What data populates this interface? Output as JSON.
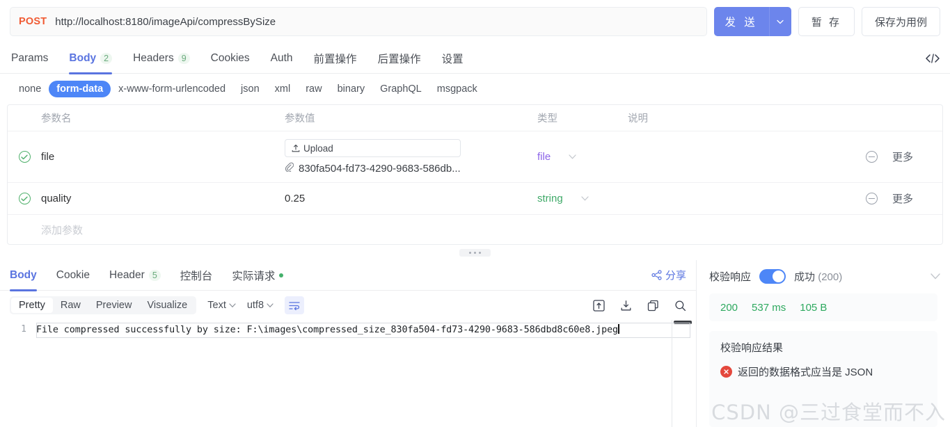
{
  "request": {
    "method": "POST",
    "url": "http://localhost:8180/imageApi/compressBySize",
    "send_label": "发 送",
    "stash_label": "暂 存",
    "save_case_label": "保存为用例"
  },
  "request_tabs": [
    {
      "label": "Params",
      "count": ""
    },
    {
      "label": "Body",
      "count": "2"
    },
    {
      "label": "Headers",
      "count": "9"
    },
    {
      "label": "Cookies",
      "count": ""
    },
    {
      "label": "Auth",
      "count": ""
    },
    {
      "label": "前置操作",
      "count": ""
    },
    {
      "label": "后置操作",
      "count": ""
    },
    {
      "label": "设置",
      "count": ""
    }
  ],
  "body_types": [
    "none",
    "form-data",
    "x-www-form-urlencoded",
    "json",
    "xml",
    "raw",
    "binary",
    "GraphQL",
    "msgpack"
  ],
  "body_type_active": "form-data",
  "param_table": {
    "headers": {
      "name": "参数名",
      "value": "参数值",
      "type": "类型",
      "desc": "说明"
    },
    "more_label": "更多",
    "upload_label": "Upload",
    "add_placeholder": "添加参数",
    "rows": [
      {
        "name": "file",
        "value": "",
        "file_name": "830fa504-fd73-4290-9683-586db...",
        "type": "file",
        "desc": ""
      },
      {
        "name": "quality",
        "value": "0.25",
        "file_name": "",
        "type": "string",
        "desc": ""
      }
    ]
  },
  "response_tabs": [
    {
      "label": "Body",
      "count": ""
    },
    {
      "label": "Cookie",
      "count": ""
    },
    {
      "label": "Header",
      "count": "5"
    },
    {
      "label": "控制台",
      "count": ""
    },
    {
      "label": "实际请求",
      "count": ""
    }
  ],
  "share_label": "分享",
  "format_bar": {
    "segments": [
      "Pretty",
      "Raw",
      "Preview",
      "Visualize"
    ],
    "active_segment": "Pretty",
    "type_dropdown": "Text",
    "encoding_dropdown": "utf8"
  },
  "response_body": {
    "line_number": "1",
    "text": "File compressed successfully by size: F:\\images\\compressed_size_830fa504-fd73-4290-9683-586dbd8c60e8.jpeg"
  },
  "verify_panel": {
    "label": "校验响应",
    "toggle_on": true,
    "status_text": "成功",
    "status_code_text": "(200)",
    "status_code": "200",
    "duration": "537 ms",
    "size": "105 B",
    "result_title": "校验响应结果",
    "result_error": "返回的数据格式应当是 JSON"
  },
  "watermark": "CSDN @三过食堂而不入",
  "colors": {
    "accent": "#5a74e0",
    "primary_button": "#6c85ec",
    "method": "#f05b34",
    "pill_active": "#4d86f7",
    "type_file": "#8b63e8",
    "type_string": "#3fa968",
    "success": "#2ea95f",
    "error": "#e4483d"
  }
}
